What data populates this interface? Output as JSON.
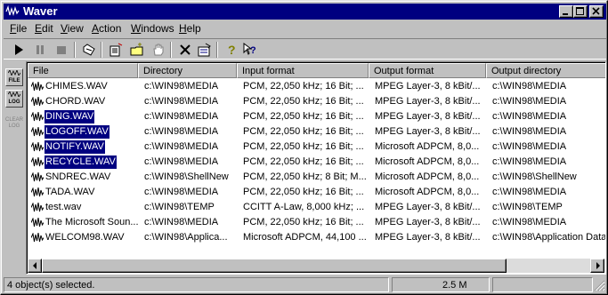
{
  "window": {
    "title": "Waver"
  },
  "title_buttons": [
    {
      "name": "minimize-button",
      "icon": "minimize-icon"
    },
    {
      "name": "maximize-button",
      "icon": "maximize-icon"
    },
    {
      "name": "close-button",
      "icon": "close-icon"
    }
  ],
  "menu": {
    "file": {
      "accel": "F",
      "rest": "ile"
    },
    "edit": {
      "accel": "E",
      "rest": "dit"
    },
    "view": {
      "accel": "V",
      "rest": "iew"
    },
    "action": {
      "accel": "A",
      "rest": "ction"
    },
    "windows": {
      "accel": "W",
      "rest": "indows"
    },
    "help": {
      "accel": "H",
      "rest": "elp"
    }
  },
  "toolbar": {
    "icons": [
      "play-icon",
      "pause-icon",
      "stop-icon",
      "open-icon",
      "add-files-icon",
      "add-folder-icon",
      "hand-icon",
      "delete-icon",
      "properties-icon",
      "help-icon",
      "context-help-icon"
    ]
  },
  "sidebar": {
    "file_tab": "FILE",
    "log_tab": "LOG",
    "clear_line1": "CLEAR",
    "clear_line2": "LOG"
  },
  "columns": {
    "file": "File",
    "directory": "Directory",
    "input_format": "Input format",
    "output_format": "Output format",
    "output_directory": "Output directory"
  },
  "rows": [
    {
      "file": "CHIMES.WAV",
      "directory": "c:\\WIN98\\MEDIA",
      "input": "PCM, 22,050 kHz; 16 Bit; ...",
      "output": "MPEG Layer-3, 8 kBit/...",
      "outdir": "c:\\WIN98\\MEDIA",
      "selected": false
    },
    {
      "file": "CHORD.WAV",
      "directory": "c:\\WIN98\\MEDIA",
      "input": "PCM, 22,050 kHz; 16 Bit; ...",
      "output": "MPEG Layer-3, 8 kBit/...",
      "outdir": "c:\\WIN98\\MEDIA",
      "selected": false
    },
    {
      "file": "DING.WAV",
      "directory": "c:\\WIN98\\MEDIA",
      "input": "PCM, 22,050 kHz; 16 Bit; ...",
      "output": "MPEG Layer-3, 8 kBit/...",
      "outdir": "c:\\WIN98\\MEDIA",
      "selected": true
    },
    {
      "file": "LOGOFF.WAV",
      "directory": "c:\\WIN98\\MEDIA",
      "input": "PCM, 22,050 kHz; 16 Bit; ...",
      "output": "MPEG Layer-3, 8 kBit/...",
      "outdir": "c:\\WIN98\\MEDIA",
      "selected": true
    },
    {
      "file": "NOTIFY.WAV",
      "directory": "c:\\WIN98\\MEDIA",
      "input": "PCM, 22,050 kHz; 16 Bit; ...",
      "output": "Microsoft ADPCM, 8,0...",
      "outdir": "c:\\WIN98\\MEDIA",
      "selected": true
    },
    {
      "file": "RECYCLE.WAV",
      "directory": "c:\\WIN98\\MEDIA",
      "input": "PCM, 22,050 kHz; 16 Bit; ...",
      "output": "Microsoft ADPCM, 8,0...",
      "outdir": "c:\\WIN98\\MEDIA",
      "selected": true
    },
    {
      "file": "SNDREC.WAV",
      "directory": "c:\\WIN98\\ShellNew",
      "input": "PCM, 22,050 kHz; 8 Bit; M...",
      "output": "Microsoft ADPCM, 8,0...",
      "outdir": "c:\\WIN98\\ShellNew",
      "selected": false
    },
    {
      "file": "TADA.WAV",
      "directory": "c:\\WIN98\\MEDIA",
      "input": "PCM, 22,050 kHz; 16 Bit; ...",
      "output": "Microsoft ADPCM, 8,0...",
      "outdir": "c:\\WIN98\\MEDIA",
      "selected": false
    },
    {
      "file": "test.wav",
      "directory": "c:\\WIN98\\TEMP",
      "input": "CCITT A-Law, 8,000 kHz; ...",
      "output": "MPEG Layer-3, 8 kBit/...",
      "outdir": "c:\\WIN98\\TEMP",
      "selected": false
    },
    {
      "file": "The Microsoft Soun...",
      "directory": "c:\\WIN98\\MEDIA",
      "input": "PCM, 22,050 kHz; 16 Bit; ...",
      "output": "MPEG Layer-3, 8 kBit/...",
      "outdir": "c:\\WIN98\\MEDIA",
      "selected": false
    },
    {
      "file": "WELCOM98.WAV",
      "directory": "c:\\WIN98\\Applica...",
      "input": "Microsoft ADPCM, 44,100 ...",
      "output": "MPEG Layer-3, 8 kBit/...",
      "outdir": "c:\\WIN98\\Application Data",
      "selected": false
    }
  ],
  "status": {
    "selection": "4 object(s) selected.",
    "size": "2.5 M",
    "extra": ""
  },
  "colors": {
    "title_bar": "#000080",
    "selection": "#000080",
    "face": "#c0c0c0"
  }
}
